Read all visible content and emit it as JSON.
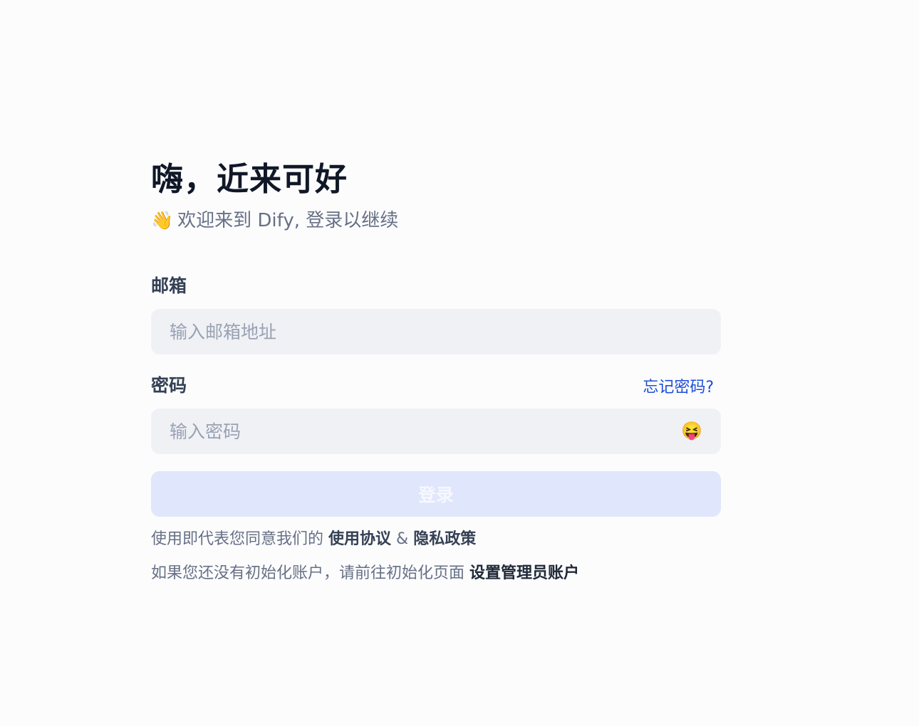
{
  "header": {
    "title": "嗨，近来可好",
    "subtitle_emoji": "👋",
    "subtitle": "欢迎来到 Dify, 登录以继续"
  },
  "email": {
    "label": "邮箱",
    "placeholder": "输入邮箱地址",
    "value": ""
  },
  "password": {
    "label": "密码",
    "forgot_label": "忘记密码?",
    "placeholder": "输入密码",
    "value": "",
    "toggle_emoji": "😝"
  },
  "login_button": {
    "label": "登录",
    "enabled": false
  },
  "terms": {
    "prefix": "使用即代表您同意我们的",
    "terms_link": "使用协议",
    "separator": "&",
    "privacy_link": "隐私政策"
  },
  "init": {
    "prefix": "如果您还没有初始化账户，请前往初始化页面",
    "admin_link": "设置管理员账户"
  },
  "colors": {
    "background": "#fcfcfd",
    "input_bg": "#f0f1f5",
    "button_disabled_bg": "#e0e6fb",
    "link_blue": "#1d4ed8",
    "muted_text": "#667085"
  }
}
